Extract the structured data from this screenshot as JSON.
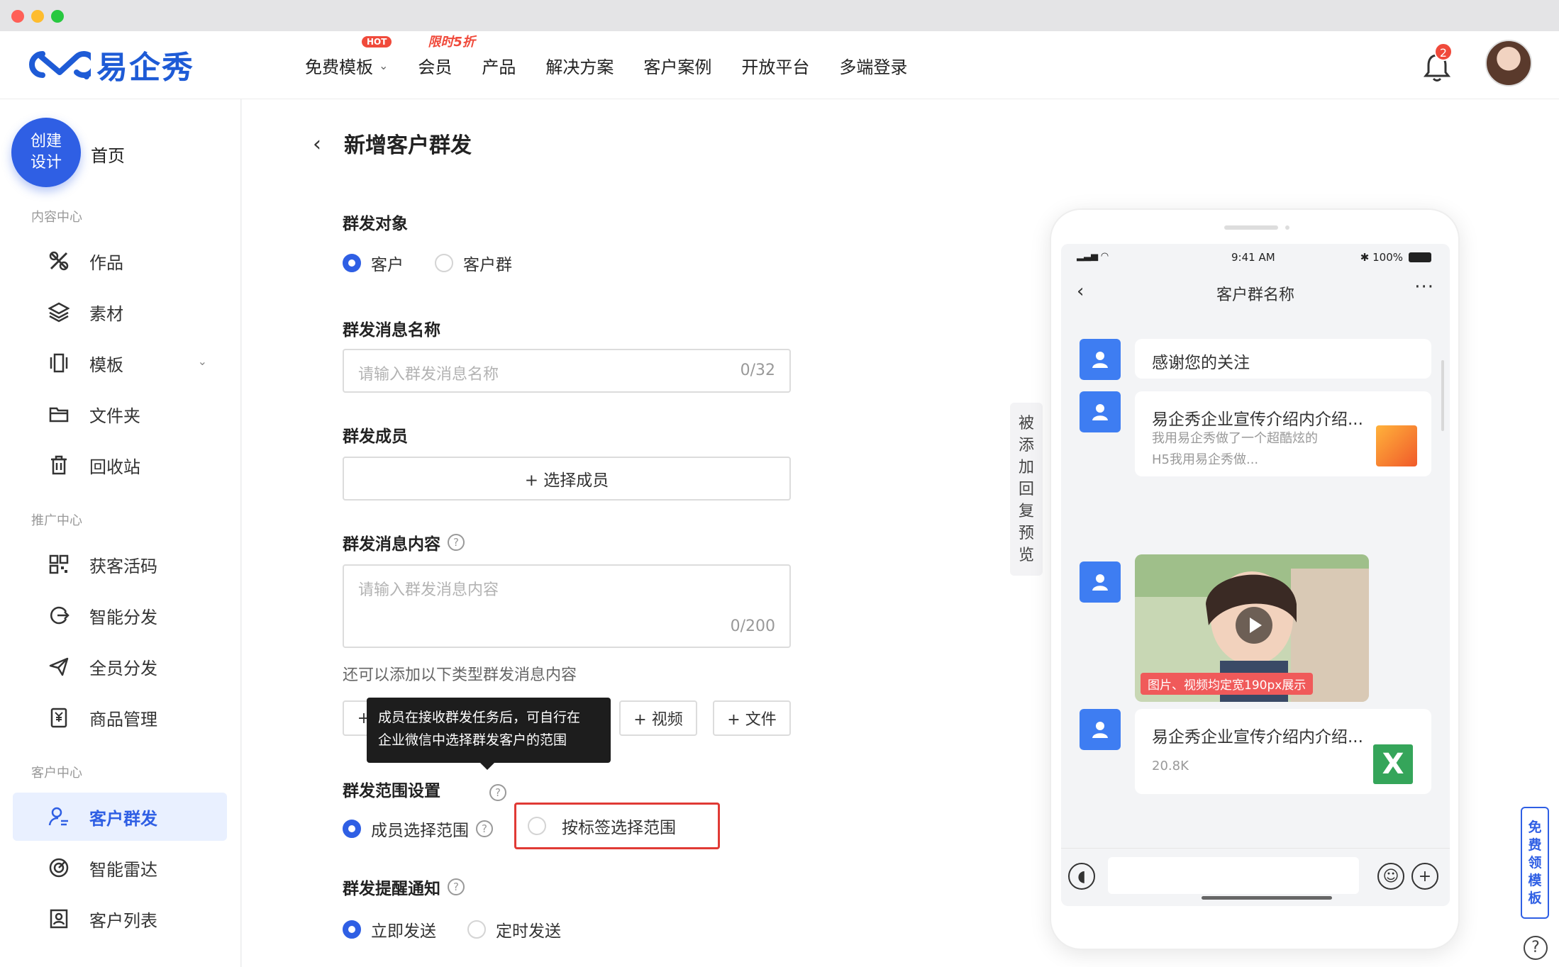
{
  "brand": {
    "name": "易企秀",
    "accent": "#2f5fe4"
  },
  "nav": {
    "items": [
      {
        "label": "免费模板",
        "badge": "HOT",
        "dropdown": true
      },
      {
        "label": "会员",
        "badge": "限时5折"
      },
      {
        "label": "产品"
      },
      {
        "label": "解决方案"
      },
      {
        "label": "客户案例"
      },
      {
        "label": "开放平台"
      },
      {
        "label": "多端登录"
      }
    ],
    "notification_count": "2"
  },
  "sidebar": {
    "create_line1": "创建",
    "create_line2": "设计",
    "home": "首页",
    "content_title": "内容中心",
    "content_items": [
      "作品",
      "素材",
      "模板",
      "文件夹",
      "回收站"
    ],
    "promo_title": "推广中心",
    "promo_items": [
      "获客活码",
      "智能分发",
      "全员分发",
      "商品管理"
    ],
    "customer_title": "客户中心",
    "customer_items": [
      "客户群发",
      "智能雷达",
      "客户列表"
    ],
    "active": "客户群发"
  },
  "form": {
    "back_icon": "chevron-left-icon",
    "title": "新增客户群发",
    "target_label": "群发对象",
    "target_options": [
      "客户",
      "客户群"
    ],
    "name_label": "群发消息名称",
    "name_placeholder": "请输入群发消息名称",
    "name_count": "0/32",
    "members_label": "群发成员",
    "members_button": "+ 选择成员",
    "content_label": "群发消息内容",
    "content_placeholder": "请输入群发消息内容",
    "content_count": "0/200",
    "content_hint": "还可以添加以下类型群发消息内容",
    "add_first": "+",
    "add_video": "+ 视频",
    "add_file": "+ 文件",
    "tooltip_line1": "成员在接收群发任务后，可自行在",
    "tooltip_line2": "企业微信中选择群发客户的范围",
    "range_label": "群发范围设置",
    "range_options": [
      "成员选择范围",
      "按标签选择范围"
    ],
    "notify_label": "群发提醒通知",
    "notify_options": [
      "立即发送",
      "定时发送"
    ]
  },
  "preview_tab": [
    "被",
    "添",
    "加",
    "回",
    "复",
    "预",
    "览"
  ],
  "phone": {
    "time": "9:41 AM",
    "battery": "100%",
    "chat_title": "客户群名称",
    "msg1": "感谢您的关注",
    "msg2_title": "易企秀企业宣传介绍内介绍...",
    "msg2_desc": "我用易企秀做了一个超酷炫的H5我用易企秀做...",
    "video_caption": "图片、视频均定宽190px展示",
    "msg4_title": "易企秀企业宣传介绍内介绍...",
    "msg4_size": "20.8K"
  },
  "right_tab": [
    "免",
    "费",
    "领",
    "模",
    "板"
  ],
  "help": "?"
}
